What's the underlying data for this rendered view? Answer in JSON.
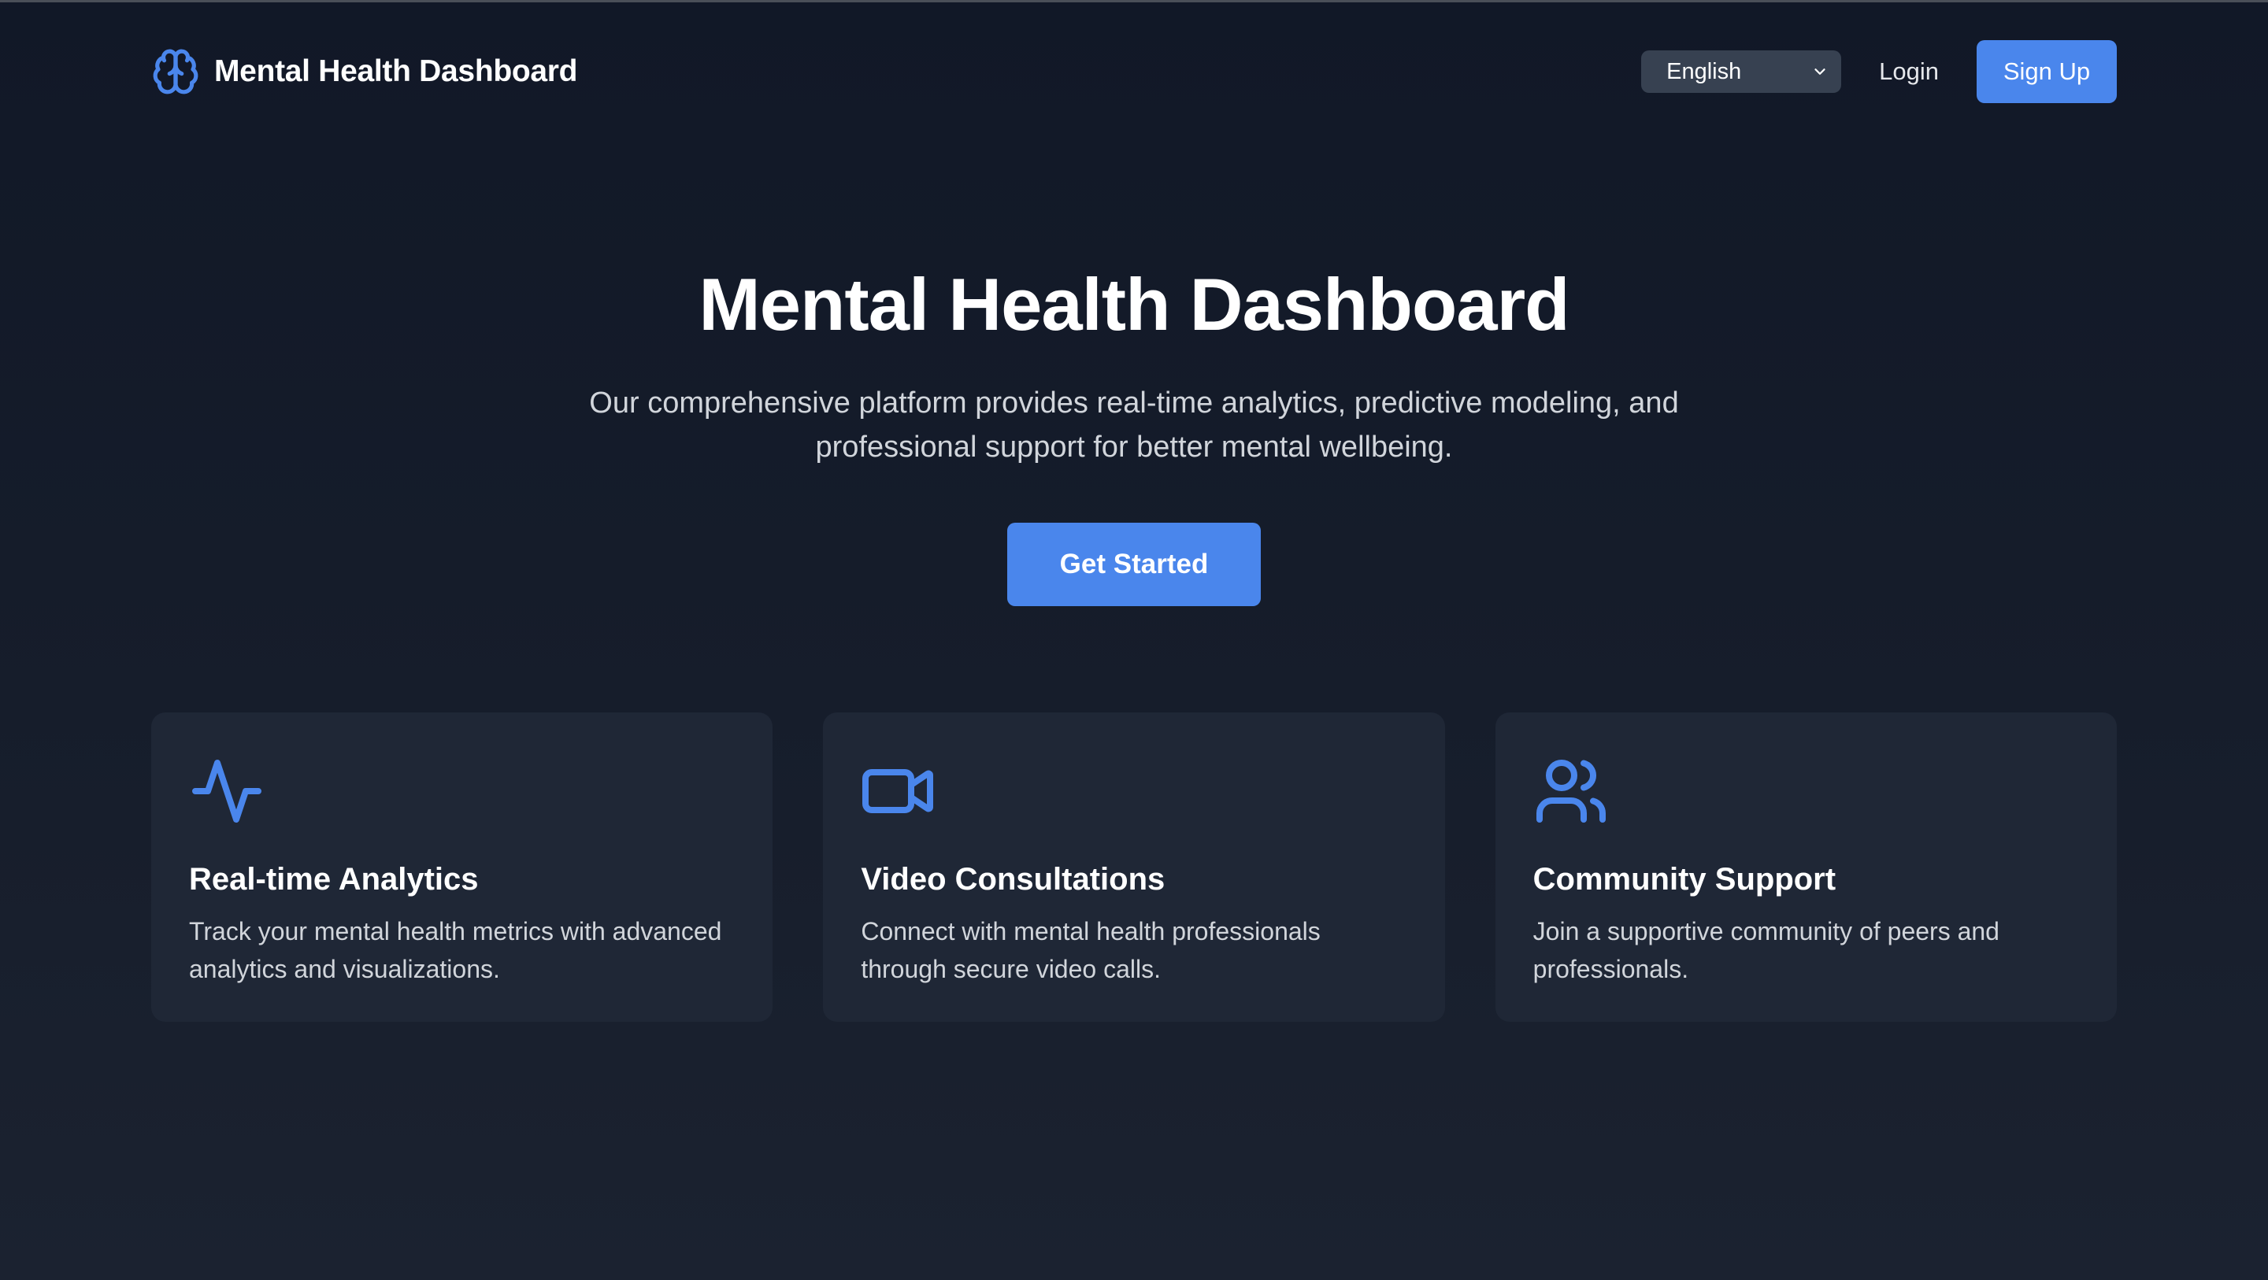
{
  "header": {
    "brand_title": "Mental Health Dashboard",
    "brand_icon": "brain-icon",
    "language_selected": "English",
    "login_label": "Login",
    "signup_label": "Sign Up"
  },
  "hero": {
    "title": "Mental Health Dashboard",
    "description": "Our comprehensive platform provides real-time analytics, predictive modeling, and professional support for better mental wellbeing.",
    "cta_label": "Get Started"
  },
  "features": [
    {
      "icon": "activity-icon",
      "title": "Real-time Analytics",
      "text": "Track your mental health metrics with advanced analytics and visualizations."
    },
    {
      "icon": "video-icon",
      "title": "Video Consultations",
      "text": "Connect with mental health professionals through secure video calls."
    },
    {
      "icon": "users-icon",
      "title": "Community Support",
      "text": "Join a supportive community of peers and professionals."
    }
  ],
  "colors": {
    "background": "#111827",
    "card": "#1f2736",
    "accent": "#4a86ec",
    "select": "#374151",
    "muted_text": "#d1d5db"
  }
}
